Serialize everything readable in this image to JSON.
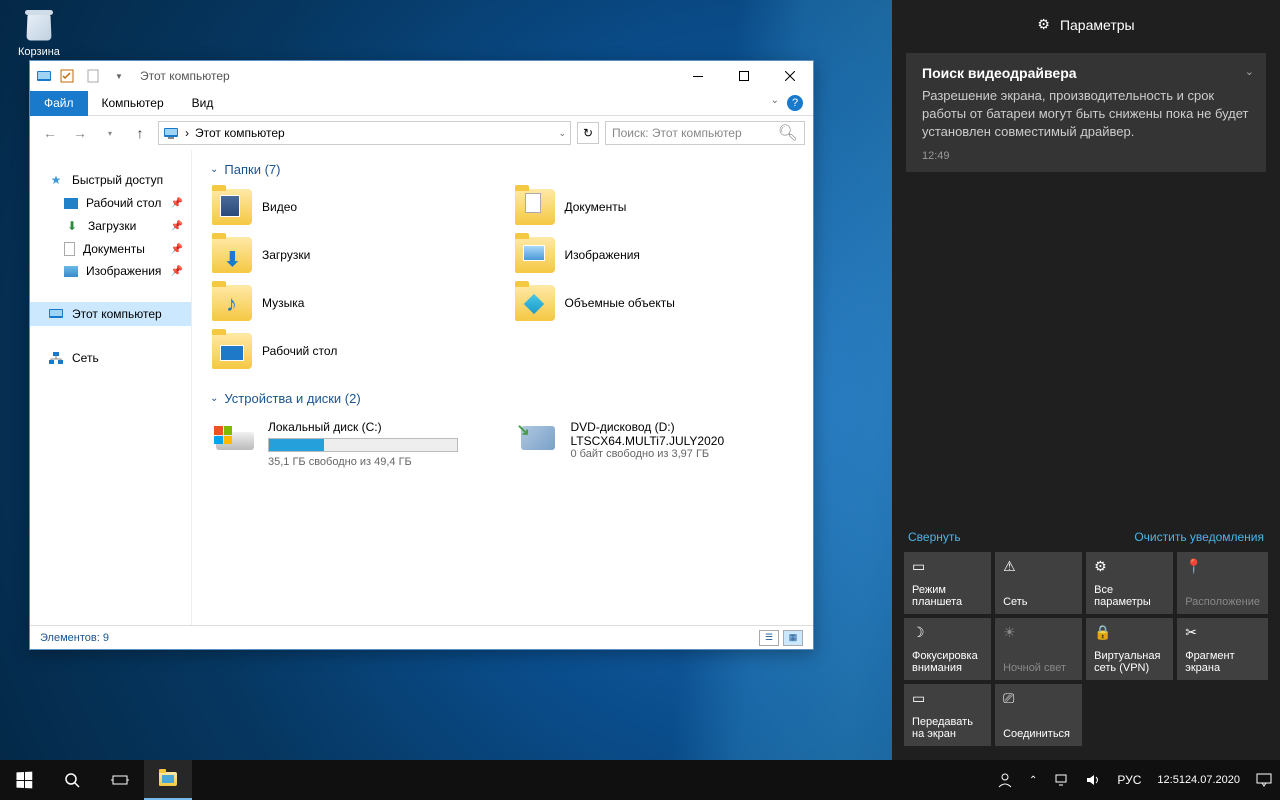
{
  "desktop": {
    "recycle_bin": "Корзина"
  },
  "window": {
    "title": "Этот компьютер",
    "tabs": {
      "file": "Файл",
      "computer": "Компьютер",
      "view": "Вид"
    },
    "address": {
      "location": "Этот компьютер",
      "sep": "›"
    },
    "search": {
      "placeholder": "Поиск: Этот компьютер"
    },
    "sidebar": {
      "quick": "Быстрый доступ",
      "q1": "Рабочий стол",
      "q2": "Загрузки",
      "q3": "Документы",
      "q4": "Изображения",
      "thispc": "Этот компьютер",
      "network": "Сеть"
    },
    "folders": {
      "header": "Папки (7)",
      "f0": "Видео",
      "f1": "Документы",
      "f2": "Загрузки",
      "f3": "Изображения",
      "f4": "Музыка",
      "f5": "Объемные объекты",
      "f6": "Рабочий стол"
    },
    "devices": {
      "header": "Устройства и диски (2)",
      "d0": {
        "name": "Локальный диск (C:)",
        "sub": "35,1 ГБ свободно из 49,4 ГБ",
        "fill_pct": 29
      },
      "d1": {
        "name": "DVD-дисковод (D:)",
        "label": "LTSCX64.MULTi7.JULY2020",
        "sub": "0 байт свободно из 3,97 ГБ"
      }
    },
    "status": "Элементов: 9"
  },
  "action_center": {
    "header": "Параметры",
    "notification": {
      "title": "Поиск видеодрайвера",
      "body": "Разрешение экрана, производительность и срок работы от батареи могут быть снижены пока не будет установлен совместимый драйвер.",
      "time": "12:49"
    },
    "collapse": "Свернуть",
    "clear": "Очистить уведомления",
    "tiles": {
      "t0": "Режим планшета",
      "t1": "Сеть",
      "t2": "Все параметры",
      "t3": "Расположение",
      "t4": "Фокусировка внимания",
      "t5": "Ночной свет",
      "t6": "Виртуальная сеть (VPN)",
      "t7": "Фрагмент экрана",
      "t8": "Передавать на экран",
      "t9": "Соединиться"
    }
  },
  "taskbar": {
    "lang": "РУС",
    "time": "12:51",
    "date": "24.07.2020"
  }
}
